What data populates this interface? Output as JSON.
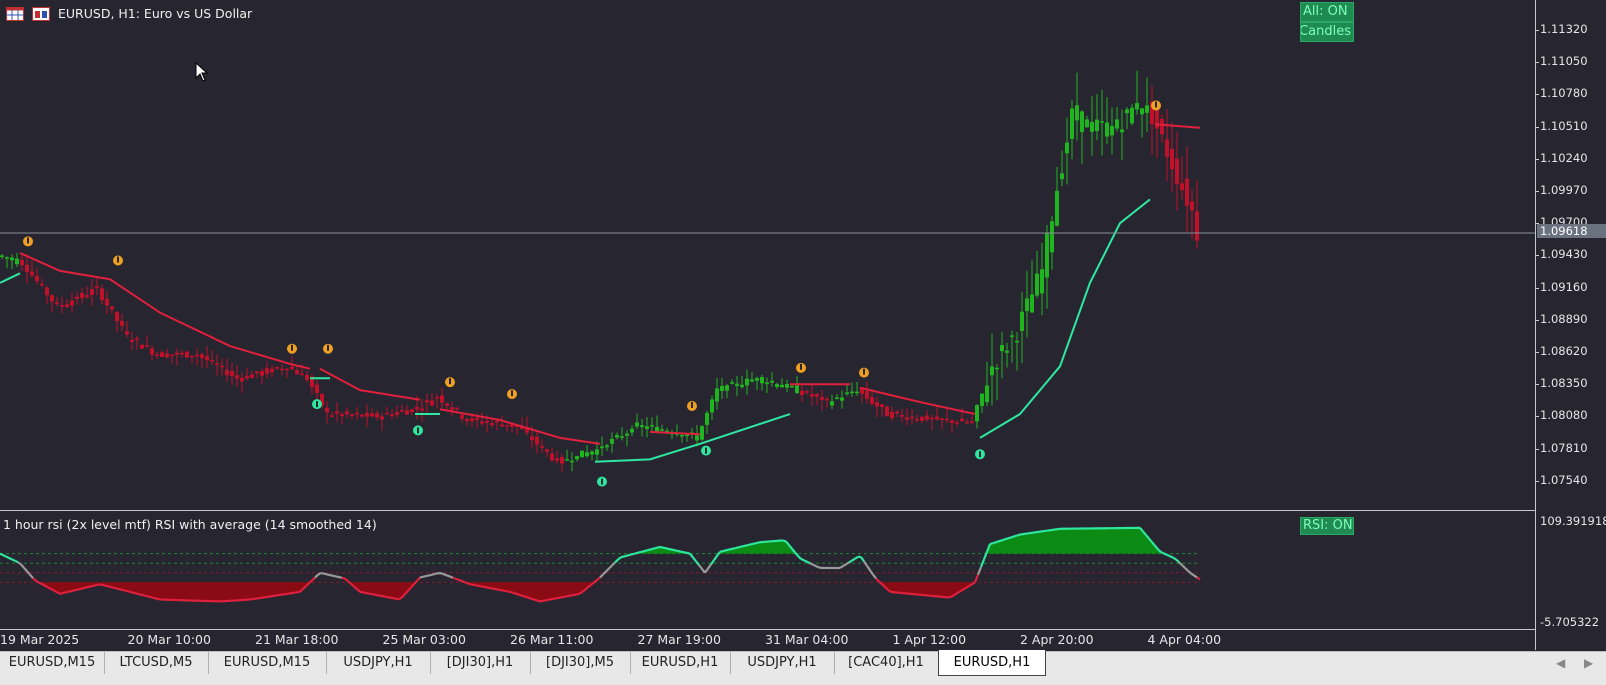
{
  "header": {
    "title": "EURUSD, H1:  Euro vs US Dollar",
    "buttons": [
      "All: ON",
      "Candles"
    ],
    "rsi_button": "RSI: ON",
    "rsi_title": "1 hour rsi (2x level mtf) RSI with average (14 smoothed 14)"
  },
  "price_axis": {
    "labels": [
      "1.11320",
      "1.11050",
      "1.10780",
      "1.10510",
      "1.10240",
      "1.09970",
      "1.09700",
      "1.09430",
      "1.09160",
      "1.08890",
      "1.08620",
      "1.08350",
      "1.08080",
      "1.07810",
      "1.07540"
    ],
    "current_price": "1.09618",
    "rsi_max": "109.391918",
    "rsi_min": "-5.705322"
  },
  "time_axis": {
    "labels": [
      "19 Mar 2025",
      "20 Mar 10:00",
      "21 Mar 18:00",
      "25 Mar 03:00",
      "26 Mar 11:00",
      "27 Mar 19:00",
      "31 Mar 04:00",
      "1 Apr 12:00",
      "2 Apr 20:00",
      "4 Apr 04:00"
    ]
  },
  "tabs": {
    "items": [
      "EURUSD,M15",
      "LTCUSD,M5",
      "EURUSD,M15",
      "USDJPY,H1",
      "[DJI30],H1",
      "[DJI30],M5",
      "EURUSD,H1",
      "USDJPY,H1",
      "[CAC40],H1",
      "EURUSD,H1"
    ],
    "active_index": 9
  },
  "colors": {
    "background": "#272530",
    "bull": "#1fb51f",
    "bear": "#c0102a",
    "trend_up": "#2ee8a0",
    "trend_down": "#e0203c",
    "rsi_up_fill": "#0b8a14",
    "rsi_down_fill": "#8a0b14"
  },
  "icons": {
    "chart-type": "table-grid-icon",
    "chart-window": "window-icon",
    "mouse": "cursor-arrow-icon"
  }
}
